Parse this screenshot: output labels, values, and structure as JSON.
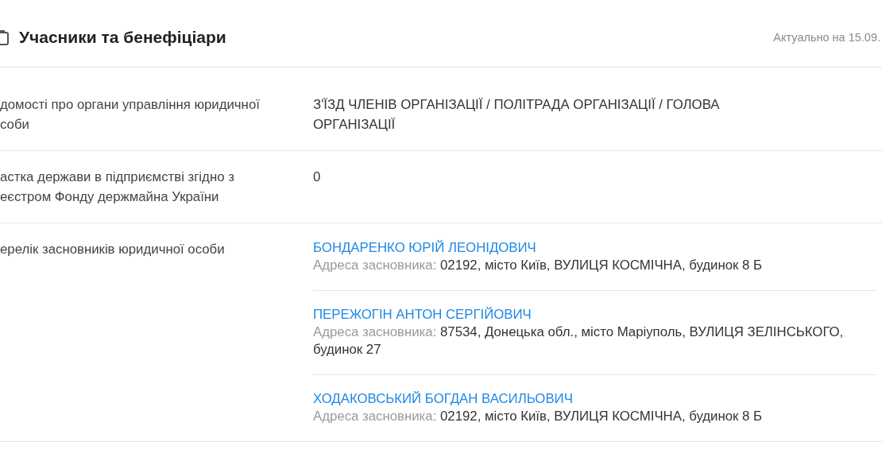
{
  "section": {
    "title": "Учасники та бенефіціари",
    "updated": "Актуально на 15.09."
  },
  "rows": [
    {
      "kind": "text",
      "label_lines": [
        "домості про органи управління юридичної",
        "соби"
      ],
      "value": "З'ЇЗД ЧЛЕНІВ ОРГАНІЗАЦІЇ / ПОЛІТРАДА ОРГАНІЗАЦІЇ / ГОЛОВА ОРГАНІЗАЦІЇ"
    },
    {
      "kind": "text",
      "label_lines": [
        "астка держави в підприємстві згідно з",
        "еєстром Фонду держмайна України"
      ],
      "value": "0"
    },
    {
      "kind": "founders",
      "label_lines": [
        "ерелік засновників юридичної особи"
      ],
      "founders": [
        {
          "name": "БОНДАРЕНКО ЮРІЙ ЛЕОНІДОВИЧ",
          "address_label": "Адреса засновника:",
          "address": "02192, місто Київ, ВУЛИЦЯ КОСМІЧНА, будинок 8 Б"
        },
        {
          "name": "ПЕРЕЖОГІН АНТОН СЕРГІЙОВИЧ",
          "address_label": "Адреса засновника:",
          "address": "87534, Донецька обл., місто Маріуполь, ВУЛИЦЯ ЗЕЛІНСЬКОГО, будинок 27"
        },
        {
          "name": "ХОДАКОВСЬКИЙ БОГДАН ВАСИЛЬОВИЧ",
          "address_label": "Адреса засновника:",
          "address": "02192, місто Київ, ВУЛИЦЯ КОСМІЧНА, будинок 8 Б"
        }
      ]
    }
  ]
}
